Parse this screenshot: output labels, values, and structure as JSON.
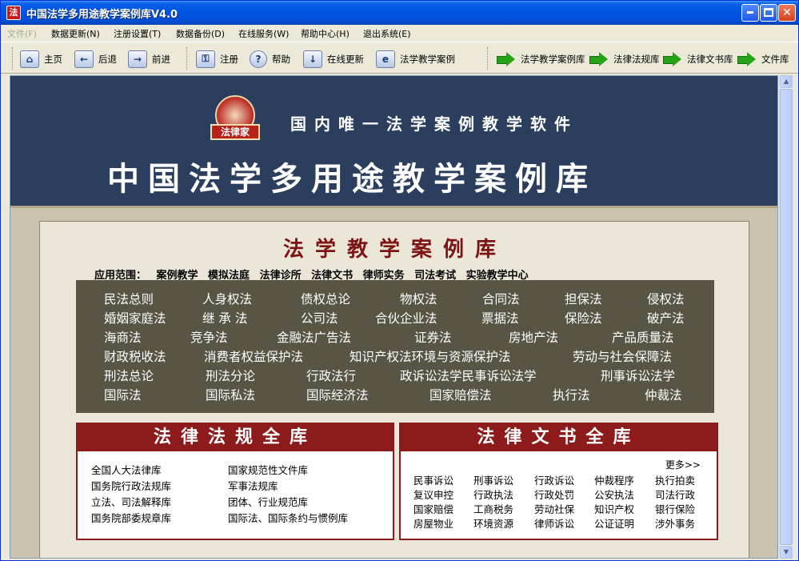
{
  "window": {
    "title": "中国法学多用途教学案例库V4.0",
    "icon": "法"
  },
  "menu": [
    "文件(F)",
    "数据更新(N)",
    "注册设置(T)",
    "数据备份(D)",
    "在线服务(W)",
    "帮助中心(H)",
    "退出系统(E)"
  ],
  "toolbar": {
    "home": "主页",
    "back": "后退",
    "forward": "前进",
    "register": "注册",
    "help": "帮助",
    "update": "在线更新",
    "case": "法学教学案例",
    "link1": "法学教学案例库",
    "link2": "法律法规库",
    "link3": "法律文书库",
    "link4": "文件库"
  },
  "banner": {
    "logo": "法律家",
    "subtitle": "国内唯一法学案例教学软件",
    "title": "中国法学多用途教学案例库"
  },
  "cases": {
    "title": "法学教学案例库",
    "scope": "应用范围： 案例教学 模拟法庭 法律诊所 法律文书 律师实务 司法考试 实验教学中心",
    "rows": [
      [
        "民法总则",
        "人身权法",
        "债权总论",
        "物权法",
        "合同法",
        "担保法",
        "侵权法"
      ],
      [
        "婚姻家庭法",
        "继 承 法",
        "公司法",
        "合伙企业法",
        "票据法",
        "保险法",
        "破产法"
      ],
      [
        "海商法",
        "竞争法",
        "金融法广告法",
        "证券法",
        "房地产法",
        "产品质量法"
      ],
      [
        "财政税收法",
        "消费者权益保护法",
        "知识产权法环境与资源保护法",
        "劳动与社会保障法"
      ],
      [
        "刑法总论",
        "刑法分论",
        "行政法行",
        "政诉讼法学民事诉讼法学",
        "刑事诉讼法学"
      ],
      [
        "国际法",
        "国际私法",
        "国际经济法",
        "国家赔偿法",
        "执行法",
        "仲裁法"
      ]
    ]
  },
  "regs": {
    "title": "法律法规全库",
    "items": [
      "全国人大法律库",
      "国家规范性文件库",
      "国务院行政法规库",
      "军事法规库",
      "立法、司法解释库",
      "团体、行业规范库",
      "国务院部委规章库",
      "国际法、国际条约与惯例库"
    ]
  },
  "docs": {
    "title": "法律文书全库",
    "more": "更多>>",
    "items": [
      [
        "民事诉讼",
        "刑事诉讼",
        "行政诉讼",
        "仲裁程序",
        "执行拍卖"
      ],
      [
        "复议申控",
        "行政执法",
        "行政处罚",
        "公安执法",
        "司法行政"
      ],
      [
        "国家赔偿",
        "工商税务",
        "劳动社保",
        "知识产权",
        "银行保险"
      ],
      [
        "房屋物业",
        "环境资源",
        "律师诉讼",
        "公证证明",
        "涉外事务"
      ]
    ]
  }
}
